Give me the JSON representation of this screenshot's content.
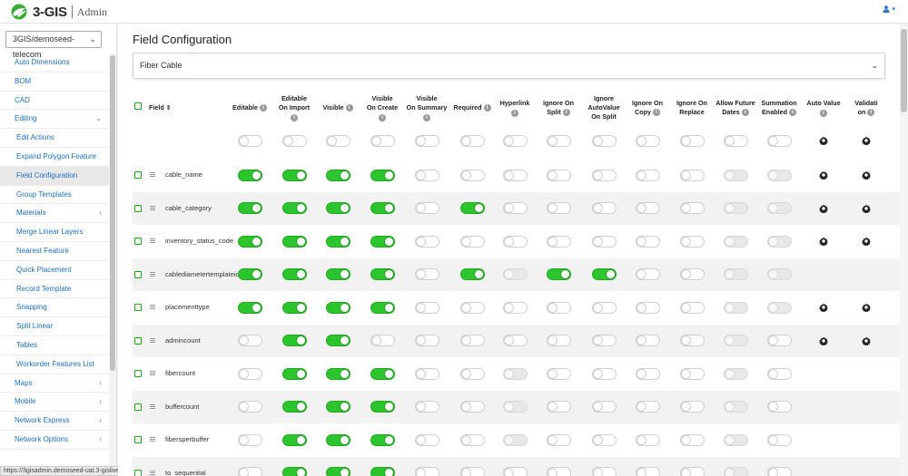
{
  "app": {
    "logo_text": "3-GIS",
    "logo_sub": "Admin",
    "brand_color": "#3aaa35",
    "user_icon": "user-icon"
  },
  "sidebar": {
    "org_select": "3GIS/demoseed-telecom",
    "items": [
      {
        "label": "Auto Dimensions",
        "sub": false,
        "active": false,
        "arrow": ""
      },
      {
        "label": "BOM",
        "sub": false,
        "active": false,
        "arrow": ""
      },
      {
        "label": "CAD",
        "sub": false,
        "active": false,
        "arrow": ""
      },
      {
        "label": "Editing",
        "sub": false,
        "active": false,
        "arrow": "⌄"
      },
      {
        "label": "Edit Actions",
        "sub": true,
        "active": false,
        "arrow": ""
      },
      {
        "label": "Expand Polygon Feature",
        "sub": true,
        "active": false,
        "arrow": ""
      },
      {
        "label": "Field Configuration",
        "sub": true,
        "active": true,
        "arrow": ""
      },
      {
        "label": "Group Templates",
        "sub": true,
        "active": false,
        "arrow": ""
      },
      {
        "label": "Materials",
        "sub": true,
        "active": false,
        "arrow": "‹"
      },
      {
        "label": "Merge Linear Layers",
        "sub": true,
        "active": false,
        "arrow": ""
      },
      {
        "label": "Nearest Feature",
        "sub": true,
        "active": false,
        "arrow": ""
      },
      {
        "label": "Quick Placement",
        "sub": true,
        "active": false,
        "arrow": ""
      },
      {
        "label": "Record Template",
        "sub": true,
        "active": false,
        "arrow": ""
      },
      {
        "label": "Snapping",
        "sub": true,
        "active": false,
        "arrow": ""
      },
      {
        "label": "Split Linear",
        "sub": true,
        "active": false,
        "arrow": ""
      },
      {
        "label": "Tables",
        "sub": true,
        "active": false,
        "arrow": ""
      },
      {
        "label": "Workorder Features List",
        "sub": true,
        "active": false,
        "arrow": ""
      },
      {
        "label": "Maps",
        "sub": false,
        "active": false,
        "arrow": "‹"
      },
      {
        "label": "Mobile",
        "sub": false,
        "active": false,
        "arrow": "‹"
      },
      {
        "label": "Network Express",
        "sub": false,
        "active": false,
        "arrow": "‹"
      },
      {
        "label": "Network Options",
        "sub": false,
        "active": false,
        "arrow": "‹"
      }
    ],
    "status_url": "https://3gisadmin.demoseed-uat.3-gislive.com/#4/Admin/"
  },
  "main": {
    "title": "Field Configuration",
    "layer": "Fiber Cable",
    "columns": [
      {
        "key": "editable",
        "lines": [
          "Editable"
        ],
        "info_inline": true
      },
      {
        "key": "editable_on_import",
        "lines": [
          "Editable",
          "On Import"
        ],
        "info_inline": false
      },
      {
        "key": "visible",
        "lines": [
          "Visible"
        ],
        "info_inline": true
      },
      {
        "key": "visible_on_create",
        "lines": [
          "Visible",
          "On Create"
        ],
        "info_inline": false
      },
      {
        "key": "visible_on_summary",
        "lines": [
          "Visible",
          "On Summary"
        ],
        "info_inline": false
      },
      {
        "key": "required",
        "lines": [
          "Required"
        ],
        "info_inline": true
      },
      {
        "key": "hyperlink",
        "lines": [
          "Hyperlink"
        ],
        "info_inline": false
      },
      {
        "key": "ignore_on_split",
        "lines": [
          "Ignore On",
          "Split"
        ],
        "info_inline": true
      },
      {
        "key": "ignore_autovalue_on_split",
        "lines": [
          "Ignore",
          "AutoValue",
          "On Split"
        ],
        "info_inline": false,
        "no_info": true
      },
      {
        "key": "ignore_on_copy",
        "lines": [
          "Ignore On",
          "Copy"
        ],
        "info_inline": true
      },
      {
        "key": "ignore_on_replace",
        "lines": [
          "Ignore On",
          "Replace"
        ],
        "info_inline": false,
        "no_info": true
      },
      {
        "key": "allow_future_dates",
        "lines": [
          "Allow Future",
          "Dates"
        ],
        "info_inline": true
      },
      {
        "key": "summation_enabled",
        "lines": [
          "Summation",
          "Enabled"
        ],
        "info_inline": true
      },
      {
        "key": "auto_value",
        "lines": [
          "Auto Value"
        ],
        "info_inline": false
      },
      {
        "key": "validation",
        "lines": [
          "Validati",
          "on"
        ],
        "info_inline": true
      }
    ],
    "field_header": "Field",
    "sort_icon": "sort-icon",
    "gear_icon": "gear-icon",
    "toggle_on_color": "#2dc52d",
    "header_row": {
      "toggles": [
        "off",
        "off",
        "off",
        "off",
        "off",
        "off",
        "off",
        "off",
        "off",
        "off",
        "off",
        "off",
        "off"
      ],
      "auto_value": true,
      "validation": true
    },
    "rows": [
      {
        "name": "cable_name",
        "toggles": [
          "on",
          "on",
          "on",
          "on",
          "off",
          "off",
          "off",
          "off",
          "off",
          "off",
          "off",
          "dis",
          "dis"
        ],
        "auto_value": true,
        "validation": true
      },
      {
        "name": "cable_category",
        "toggles": [
          "on",
          "on",
          "on",
          "on",
          "off",
          "on",
          "off",
          "off",
          "off",
          "off",
          "off",
          "dis",
          "dis"
        ],
        "auto_value": true,
        "validation": true
      },
      {
        "name": "inventory_status_code",
        "toggles": [
          "on",
          "on",
          "on",
          "on",
          "off",
          "off",
          "off",
          "off",
          "off",
          "off",
          "off",
          "dis",
          "dis"
        ],
        "auto_value": true,
        "validation": true
      },
      {
        "name": "cablediametertemplateid",
        "toggles": [
          "on",
          "on",
          "on",
          "on",
          "off",
          "on",
          "dis",
          "on",
          "on",
          "off",
          "off",
          "dis",
          "dis"
        ],
        "auto_value": false,
        "validation": false
      },
      {
        "name": "placementtype",
        "toggles": [
          "on",
          "on",
          "on",
          "on",
          "off",
          "off",
          "off",
          "off",
          "off",
          "off",
          "off",
          "dis",
          "dis"
        ],
        "auto_value": true,
        "validation": true
      },
      {
        "name": "admincount",
        "toggles": [
          "off",
          "on",
          "on",
          "off",
          "off",
          "off",
          "off",
          "off",
          "off",
          "off",
          "off",
          "dis",
          "off"
        ],
        "auto_value": true,
        "validation": true
      },
      {
        "name": "fibercount",
        "toggles": [
          "off",
          "on",
          "on",
          "on",
          "off",
          "off",
          "dis",
          "off",
          "off",
          "off",
          "off",
          "dis",
          "off"
        ],
        "auto_value": false,
        "validation": false
      },
      {
        "name": "buffercount",
        "toggles": [
          "off",
          "on",
          "on",
          "on",
          "off",
          "off",
          "dis",
          "off",
          "off",
          "off",
          "off",
          "dis",
          "off"
        ],
        "auto_value": false,
        "validation": false
      },
      {
        "name": "fibersperbuffer",
        "toggles": [
          "off",
          "on",
          "on",
          "on",
          "off",
          "off",
          "dis",
          "off",
          "off",
          "off",
          "off",
          "dis",
          "off"
        ],
        "auto_value": false,
        "validation": false
      },
      {
        "name": "to_sequential",
        "toggles": [
          "off",
          "on",
          "on",
          "on",
          "off",
          "off",
          "off",
          "off",
          "off",
          "off",
          "off",
          "dis",
          "off"
        ],
        "auto_value": false,
        "validation": false
      }
    ]
  }
}
